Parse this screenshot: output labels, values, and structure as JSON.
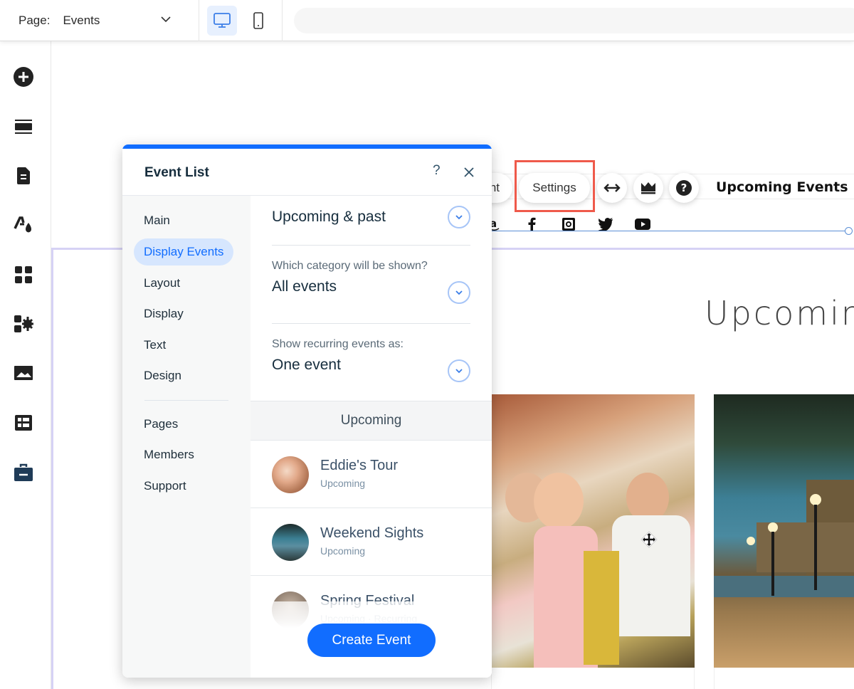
{
  "topbar": {
    "page_label": "Page:",
    "page_value": "Events",
    "devices": [
      {
        "name": "desktop",
        "icon": "desktop-icon",
        "active": true
      },
      {
        "name": "mobile",
        "icon": "mobile-icon",
        "active": false
      }
    ]
  },
  "rail": {
    "items": [
      {
        "icon": "add-icon",
        "label": "Add"
      },
      {
        "icon": "sections-icon",
        "label": "Sections"
      },
      {
        "icon": "pages-icon",
        "label": "Pages"
      },
      {
        "icon": "theme-icon",
        "label": "Site Design"
      },
      {
        "icon": "apps-icon",
        "label": "Apps"
      },
      {
        "icon": "app-settings-icon",
        "label": "Add Apps"
      },
      {
        "icon": "media-icon",
        "label": "Media"
      },
      {
        "icon": "cms-icon",
        "label": "CMS"
      },
      {
        "icon": "business-icon",
        "label": "My Business"
      }
    ]
  },
  "canvas": {
    "header_title": "Upcoming Events",
    "section_title": "Upcomin",
    "social_icons": [
      "amazon-icon",
      "facebook-icon",
      "instagram-icon",
      "twitter-icon",
      "youtube-icon"
    ],
    "photos": [
      {
        "name": "bus-tour-photo"
      },
      {
        "name": "london-riverside-photo"
      }
    ]
  },
  "floating_toolbar": {
    "partial_label": "nt",
    "settings_label": "Settings",
    "icons": [
      "stretch-icon",
      "upgrade-crown-icon",
      "help-icon"
    ]
  },
  "panel": {
    "title": "Event List",
    "help": "?",
    "nav": [
      {
        "label": "Main",
        "active": false
      },
      {
        "label": "Display Events",
        "active": true
      },
      {
        "label": "Layout",
        "active": false
      },
      {
        "label": "Display",
        "active": false
      },
      {
        "label": "Text",
        "active": false
      },
      {
        "label": "Design",
        "active": false
      }
    ],
    "nav_secondary": [
      {
        "label": "Pages"
      },
      {
        "label": "Members"
      },
      {
        "label": "Support"
      }
    ],
    "dropdowns": [
      {
        "label": "",
        "value": "Upcoming & past"
      },
      {
        "label": "Which category will be shown?",
        "value": "All events"
      },
      {
        "label": "Show recurring events as:",
        "value": "One event"
      }
    ],
    "list_header": "Upcoming",
    "events": [
      {
        "name": "Eddie's Tour",
        "status": "Upcoming"
      },
      {
        "name": "Weekend Sights",
        "status": "Upcoming"
      },
      {
        "name": "Spring Festival",
        "status": "Upcoming · Recurring"
      }
    ],
    "create_button": "Create Event"
  },
  "colors": {
    "accent": "#116dff",
    "active_nav_bg": "#d6e6fe",
    "highlight": "#ef5a4b",
    "section_outline": "#d6d2f5"
  }
}
